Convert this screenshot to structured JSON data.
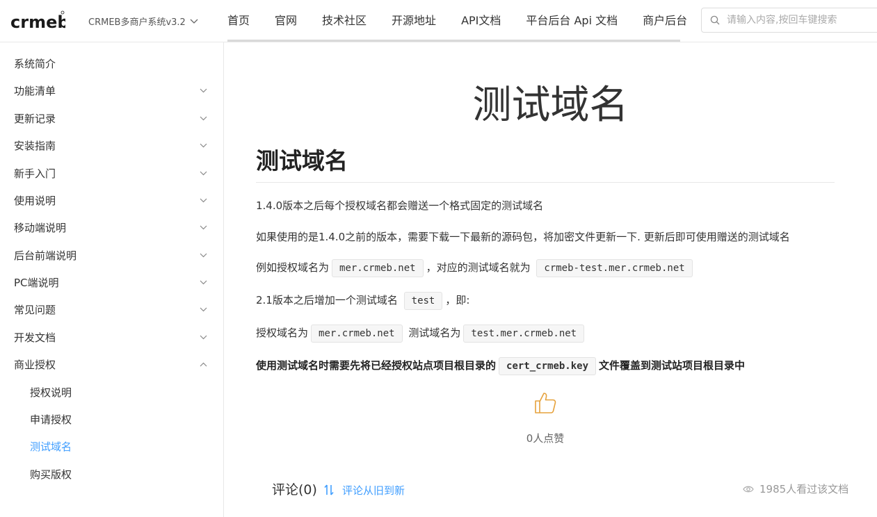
{
  "header": {
    "logo_text": "crmeb",
    "version_label": "CRMEB多商户系统v3.2",
    "nav": [
      "首页",
      "官网",
      "技术社区",
      "开源地址",
      "API文档",
      "平台后台 Api 文档",
      "商户后台"
    ],
    "search_placeholder": "请输入内容,按回车键搜索"
  },
  "sidebar": {
    "items": [
      {
        "label": "系统简介",
        "expandable": false
      },
      {
        "label": "功能清单",
        "expandable": true
      },
      {
        "label": "更新记录",
        "expandable": true
      },
      {
        "label": "安装指南",
        "expandable": true
      },
      {
        "label": "新手入门",
        "expandable": true
      },
      {
        "label": "使用说明",
        "expandable": true
      },
      {
        "label": "移动端说明",
        "expandable": true
      },
      {
        "label": "后台前端说明",
        "expandable": true
      },
      {
        "label": "PC端说明",
        "expandable": true
      },
      {
        "label": "常见问题",
        "expandable": true
      },
      {
        "label": "开发文档",
        "expandable": true
      },
      {
        "label": "商业授权",
        "expandable": true,
        "expanded": true
      }
    ],
    "sub_items": [
      "授权说明",
      "申请授权",
      "测试域名",
      "购买版权"
    ],
    "active_sub": "测试域名"
  },
  "content": {
    "page_title": "测试域名",
    "heading": "测试域名",
    "p1": "1.4.0版本之后每个授权域名都会赠送一个格式固定的测试域名",
    "p2": "如果使用的是1.4.0之前的版本，需要下载一下最新的源码包，将加密文件更新一下. 更新后即可使用赠送的测试域名",
    "p3_prefix": "例如授权域名为",
    "p3_code1": "mer.crmeb.net",
    "p3_mid": "，对应的测试域名就为",
    "p3_code2": "crmeb-test.mer.crmeb.net",
    "p4_prefix": "2.1版本之后增加一个测试域名",
    "p4_code": "test",
    "p4_suffix": "，即:",
    "p5_prefix": "授权域名为",
    "p5_code1": "mer.crmeb.net",
    "p5_mid": "测试域名为",
    "p5_code2": "test.mer.crmeb.net",
    "p6_prefix": "使用测试域名时需要先将已经授权站点项目根目录的",
    "p6_code": "cert_crmeb.key",
    "p6_suffix": "文件覆盖到测试站项目根目录中",
    "like_count": "0人点赞",
    "comments_label": "评论(0)",
    "sort_label": "评论从旧到新",
    "views_label": "1985人看过该文档"
  },
  "colors": {
    "accent": "#409eff",
    "like_icon": "#e6a23c"
  }
}
